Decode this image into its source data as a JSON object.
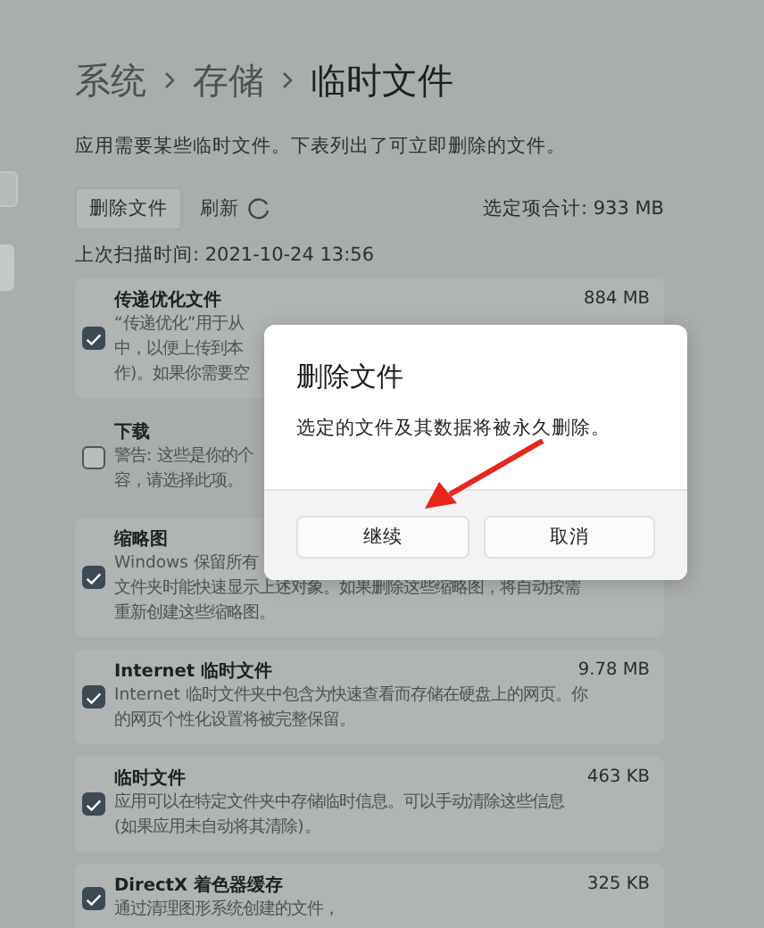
{
  "breadcrumb": [
    {
      "label": "系统",
      "current": false
    },
    {
      "label": "存储",
      "current": false
    },
    {
      "label": "临时文件",
      "current": true
    }
  ],
  "intro": "应用需要某些临时文件。下表列出了可立即删除的文件。",
  "toolbar": {
    "delete_button": "删除文件",
    "refresh_link": "刷新",
    "total": "选定项合计: 933 MB"
  },
  "last_scan": "上次扫描时间: 2021-10-24 13:56",
  "items": [
    {
      "title": "传递优化文件",
      "size": "884 MB",
      "checked": true,
      "lines": [
        "“传递优化”用于从",
        "中，以便上传到本",
        "作)。如果你需要空"
      ]
    },
    {
      "title": "下载",
      "checked": false,
      "lines": [
        "警告: 这些是你的个",
        "容，请选择此项。"
      ]
    },
    {
      "title": "缩略图",
      "checked": true,
      "lines": [
        "Windows 保留所有",
        "文件夹时能快速显示上述对象。如果删除这些缩略图，将自动按需",
        "重新创建这些缩略图。"
      ]
    },
    {
      "title": "Internet 临时文件",
      "size": "9.78 MB",
      "checked": true,
      "lines": [
        "Internet 临时文件夹中包含为快速查看而存储在硬盘上的网页。你",
        "的网页个性化设置将被完整保留。"
      ]
    },
    {
      "title": "临时文件",
      "size": "463 KB",
      "checked": true,
      "lines": [
        "应用可以在特定文件夹中存储临时信息。可以手动清除这些信息",
        "(如果应用未自动将其清除)。"
      ]
    },
    {
      "title": "DirectX 着色器缓存",
      "size": "325 KB",
      "checked": true,
      "lines": [
        "通过清理图形系统创建的文件，"
      ]
    }
  ],
  "dialog": {
    "title": "删除文件",
    "message": "选定的文件及其数据将被永久删除。",
    "buttons": [
      "继续",
      "取消"
    ]
  }
}
